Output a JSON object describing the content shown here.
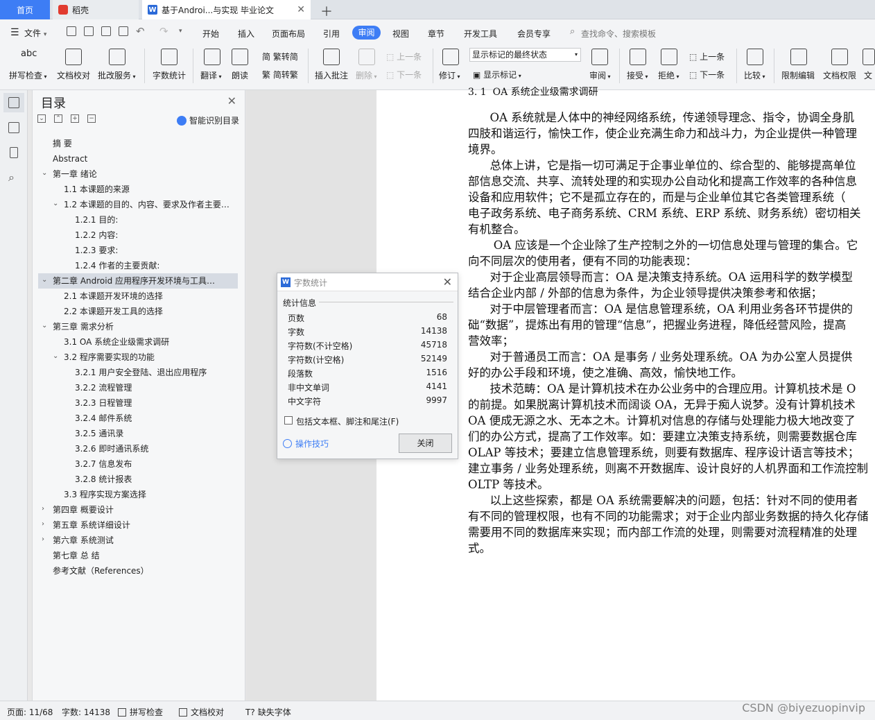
{
  "tabs": {
    "home": "首页",
    "daoke": "稻壳",
    "doc": "基于Androi...与实现 毕业论文"
  },
  "menu": {
    "file": "文件",
    "items": [
      "开始",
      "插入",
      "页面布局",
      "引用",
      "审阅",
      "视图",
      "章节",
      "开发工具",
      "会员专享"
    ],
    "search": "查找命令、搜索模板"
  },
  "toolbar": {
    "spell": "拼写检查",
    "doccheck": "文档校对",
    "annotate_service": "批改服务",
    "wordcount": "字数统计",
    "translate": "翻译",
    "read": "朗读",
    "trad": "繁转简",
    "simp": "简转繁",
    "insert_comment": "插入批注",
    "delete": "删除",
    "prev": "上一条",
    "next": "下一条",
    "revise": "修订",
    "show_final": "显示标记的最终状态",
    "show_marks": "显示标记",
    "review": "审阅",
    "accept": "接受",
    "reject": "拒绝",
    "prev2": "上一条",
    "next2": "下一条",
    "compare": "比较",
    "restrict": "限制编辑",
    "doc_perm": "文档权限",
    "doc_more": "文"
  },
  "toc": {
    "title": "目录",
    "smart": "智能识别目录",
    "items": [
      "摘    要",
      "Abstract",
      "第一章    绪论",
      "1.1 本课题的来源",
      "1.2 本课题的目的、内容、要求及作者主要…",
      "1.2.1 目的:",
      "1.2.2 内容:",
      "1.2.3 要求:",
      "1.2.4 作者的主要贡献:",
      "第二章      Android 应用程序开发环境与工具…",
      "2.1 本课题开发环境的选择",
      "2.2 本课题开发工具的选择",
      "第三章      需求分析",
      "3.1 OA 系统企业级需求调研",
      "3.2 程序需要实现的功能",
      "3.2.1  用户安全登陆、退出应用程序",
      "3.2.2  流程管理",
      "3.2.3  日程管理",
      "3.2.4  邮件系统",
      "3.2.5  通讯录",
      "3.2.6  即时通讯系统",
      "3.2.7  信息发布",
      "3.2.8  统计报表",
      "3.3  程序实现方案选择",
      "第四章      概要设计",
      "第五章      系统详细设计",
      "第六章      系统测试",
      "第七章  总  结",
      "参考文献（References）"
    ]
  },
  "document": {
    "lines": [
      "3. 1  OA 系统企业级需求调研",
      "",
      "      OA 系统就是人体中的神经网络系统，传递领导理念、指令，协调全身肌",
      "四肢和谐运行，愉快工作，使企业充满生命力和战斗力，为企业提供一种管理",
      "境界。",
      "      总体上讲，它是指一切可满足于企事业单位的、综合型的、能够提高单位",
      "部信息交流、共享、流转处理的和实现办公自动化和提高工作效率的各种信息",
      "设备和应用软件；它不是孤立存在的，而是与企业单位其它各类管理系统（",
      "电子政务系统、电子商务系统、CRM 系统、ERP 系统、财务系统）密切相关",
      "有机整合。",
      "       OA 应该是一个企业除了生产控制之外的一切信息处理与管理的集合。它",
      "向不同层次的使用者，便有不同的功能表现：",
      "      对于企业高层领导而言：OA 是决策支持系统。OA 运用科学的数学模型",
      "结合企业内部 / 外部的信息为条件，为企业领导提供决策参考和依据；",
      "      对于中层管理者而言：OA 是信息管理系统，OA 利用业务各环节提供的",
      "础“数据”，提炼出有用的管理“信息”，把握业务进程，降低经营风险，提高",
      "营效率；",
      "      对于普通员工而言：OA 是事务 / 业务处理系统。OA 为办公室人员提供",
      "好的办公手段和环境，使之准确、高效，愉快地工作。",
      "      技术范畴：OA 是计算机技术在办公业务中的合理应用。计算机技术是 O",
      "的前提。如果脱离计算机技术而阔谈 OA，无异于痴人说梦。没有计算机技术",
      "OA 便成无源之水、无本之木。计算机对信息的存储与处理能力极大地改变了",
      "们的办公方式，提高了工作效率。如：要建立决策支持系统，则需要数据仓库",
      "OLAP 等技术；要建立信息管理系统，则要有数据库、程序设计语言等技术；",
      "建立事务 / 业务处理系统，则离不开数据库、设计良好的人机界面和工作流控制",
      "OLTP 等技术。",
      "      以上这些探索，都是 OA 系统需要解决的问题，包括：针对不同的使用者",
      "有不同的管理权限，也有不同的功能需求；对于企业内部业务数据的持久化存储",
      "需要用不同的数据库来实现；而内部工作流的处理，则需要对流程精准的处理",
      "式。"
    ]
  },
  "dialog": {
    "title": "字数统计",
    "group": "统计信息",
    "rows": [
      {
        "label": "页数",
        "value": "68"
      },
      {
        "label": "字数",
        "value": "14138"
      },
      {
        "label": "字符数(不计空格)",
        "value": "45718"
      },
      {
        "label": "字符数(计空格)",
        "value": "52149"
      },
      {
        "label": "段落数",
        "value": "1516"
      },
      {
        "label": "非中文单词",
        "value": "4141"
      },
      {
        "label": "中文字符",
        "value": "9997"
      }
    ],
    "checkbox": "包括文本框、脚注和尾注(F)",
    "tips": "操作技巧",
    "close": "关闭"
  },
  "status": {
    "page": "页面: 11/68",
    "words": "字数: 14138",
    "spell": "拼写检查",
    "doccheck": "文档校对",
    "missing_font": "缺失字体",
    "watermark": "CSDN @biyezuopinvip"
  },
  "colors": {
    "accent": "#3d7df5",
    "tab_home": "#3d7df5"
  }
}
